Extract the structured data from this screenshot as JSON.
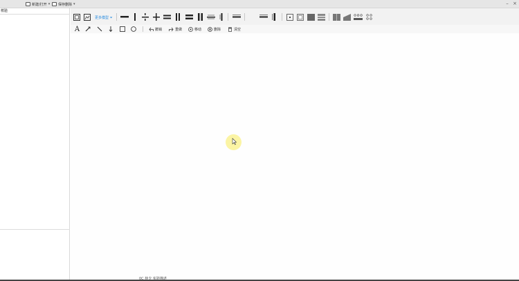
{
  "titlebar": {
    "new_open_label": "新建/打开",
    "save_label": "保存删除",
    "caret": "▾",
    "minimize": "–",
    "close": "×"
  },
  "left_panel": {
    "header": "校验"
  },
  "toolbar1": {
    "dropdown_label": "更多模型 ⏷",
    "icons": [
      "frame-icon",
      "image-frame-icon",
      "line-horizontal-icon",
      "line-vertical-icon",
      "divide-icon",
      "plus-cross-icon",
      "double-line-horizontal-icon",
      "double-line-vertical-icon",
      "equal-bold-icon",
      "double-vertical-bold-icon",
      "marked-line-icon",
      "marked-column-icon",
      "scale-bar-icon",
      "scale-bar-2-icon",
      "scale-column-icon",
      "box-small-icon",
      "box-shadow-icon",
      "box-fill-icon",
      "box-lines-icon",
      "grid-block-icon",
      "slope-block-icon",
      "dots-grid-icon",
      "dots-box-icon"
    ]
  },
  "toolbar2": {
    "text_tool": "A",
    "undo_label": "撤销",
    "redo_label": "重做",
    "move_label": "移动",
    "delete_label": "删除",
    "clear_label": "清空"
  },
  "canvas": {
    "bottom_text": "0C 林夕 实验描述"
  },
  "colors": {
    "accent": "#2c8ee0",
    "halo": "#fbf39a"
  }
}
